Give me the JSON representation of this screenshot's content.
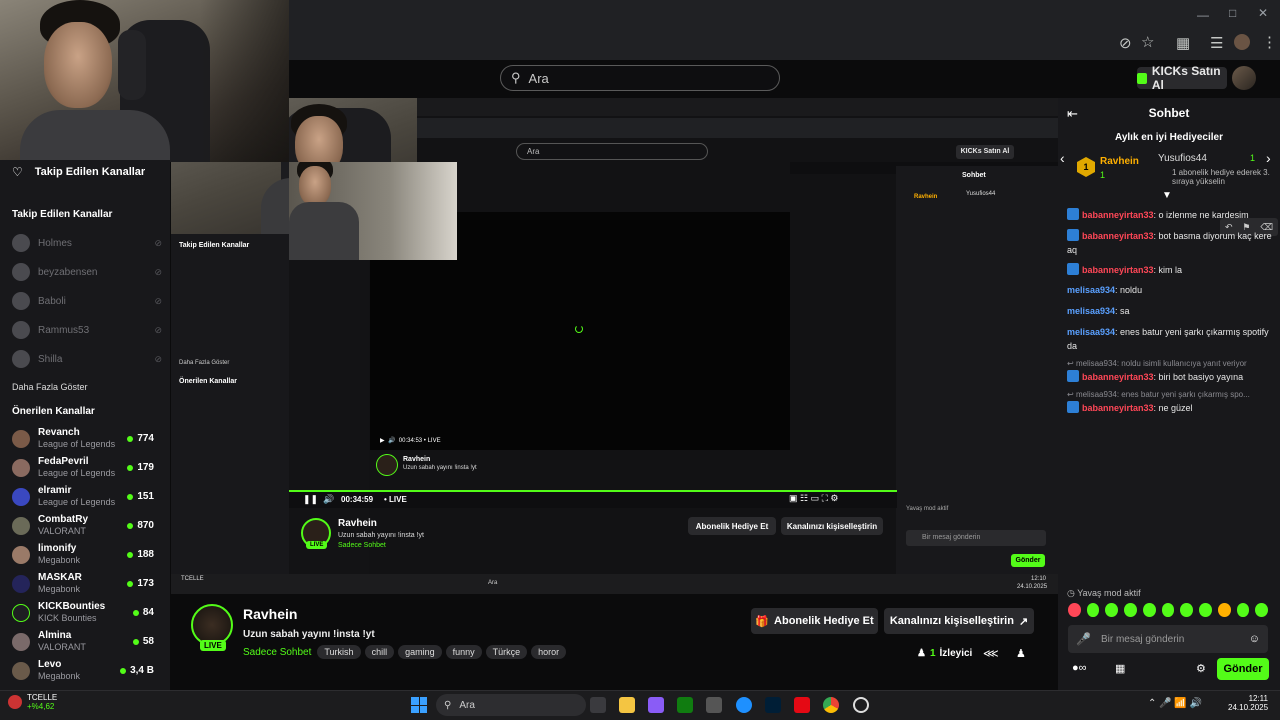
{
  "header": {
    "search_placeholder": "Ara",
    "kicks_label": "KICKs Satın Al"
  },
  "sidebar": {
    "followed_heading": "Takip Edilen Kanallar",
    "followed_heading2": "Takip Edilen Kanallar",
    "offline": [
      "Holmes",
      "beyzabensen",
      "Baboli",
      "Rammus53",
      "Shilla"
    ],
    "show_more": "Daha Fazla Göster",
    "recommended_heading": "Önerilen Kanallar",
    "recommended": [
      {
        "name": "Revanch",
        "game": "League of Legends",
        "viewers": "774"
      },
      {
        "name": "FedaPevril",
        "game": "League of Legends",
        "viewers": "179"
      },
      {
        "name": "elramir",
        "game": "League of Legends",
        "viewers": "151"
      },
      {
        "name": "CombatRy",
        "game": "VALORANT",
        "viewers": "870"
      },
      {
        "name": "limonify",
        "game": "Megabonk",
        "viewers": "188"
      },
      {
        "name": "MASKAR",
        "game": "Megabonk",
        "viewers": "173"
      },
      {
        "name": "KICKBounties",
        "game": "KICK Bounties",
        "viewers": "84"
      },
      {
        "name": "Almina",
        "game": "VALORANT",
        "viewers": "58"
      },
      {
        "name": "Levo",
        "game": "Megabonk",
        "viewers": "3,4 B"
      }
    ]
  },
  "stream": {
    "channel": "Ravhein",
    "title": "Uzun sabah yayını !insta !yt",
    "chat_mode": "Sadece Sohbet",
    "tags": [
      "Turkish",
      "chill",
      "gaming",
      "funny",
      "Türkçe",
      "horor"
    ],
    "gift_sub": "Abonelik Hediye Et",
    "customize": "Kanalınızı kişiselleştirin",
    "viewers_count": "1",
    "viewers_label": "İzleyici",
    "live": "LIVE",
    "time": "00:34:59",
    "nested_time": "00:34:53"
  },
  "chat": {
    "title": "Sohbet",
    "top_gifters": "Aylık en iyi Hediyeciler",
    "gifter1": "Ravhein",
    "gifter1_count": "1",
    "gifter2": "Yusufios44",
    "gifter2_count": "1",
    "gifter_hint": "1 abonelik hediye ederek 3. sıraya yükselin",
    "messages": [
      {
        "user": "babanneyirtan33",
        "text": ": o izlenme ne kardeşim"
      },
      {
        "user": "babanneyirtan33",
        "text": ": bot basma diyorum kaç kere aq"
      },
      {
        "user": "babanneyirtan33",
        "text": ": kim la"
      },
      {
        "user": "melisaa934",
        "text": ": noldu"
      },
      {
        "user": "melisaa934",
        "text": ": sa"
      },
      {
        "user": "melisaa934",
        "text": ": enes batur yeni şarkı çıkarmış spotify da"
      },
      {
        "user": "babanneyirtan33",
        "text": ": biri bot basiyo yayına"
      },
      {
        "user": "babanneyirtan33",
        "text": ": ne güzel"
      }
    ],
    "reply1": "melisaa934: noldu isimli kullanıcıya yanıt veriyor",
    "reply2": "melisaa934: enes batur yeni şarkı çıkarmış spo...",
    "slow_mode": "Yavaş mod aktif",
    "input_placeholder": "Bir mesaj gönderin",
    "send": "Gönder"
  },
  "nested": {
    "chat_title": "Sohbet",
    "top_gifters": "Aylık en iyi Hediyeciler",
    "slow_mode": "Yavaş mod aktif",
    "input_placeholder": "Bir mesaj gönderin",
    "send": "Gönder",
    "tb_search": "Ara",
    "tb_time": "12:10",
    "tb_date": "24.10.2025"
  },
  "taskbar": {
    "search": "Ara",
    "ticker": "TCELLE",
    "ticker_change": "+%4,62",
    "time": "12:11",
    "date": "24.10.2025"
  },
  "colors": {
    "accent": "#53fc18",
    "red_user": "#ff4757",
    "blue_user": "#5aa0ff"
  }
}
